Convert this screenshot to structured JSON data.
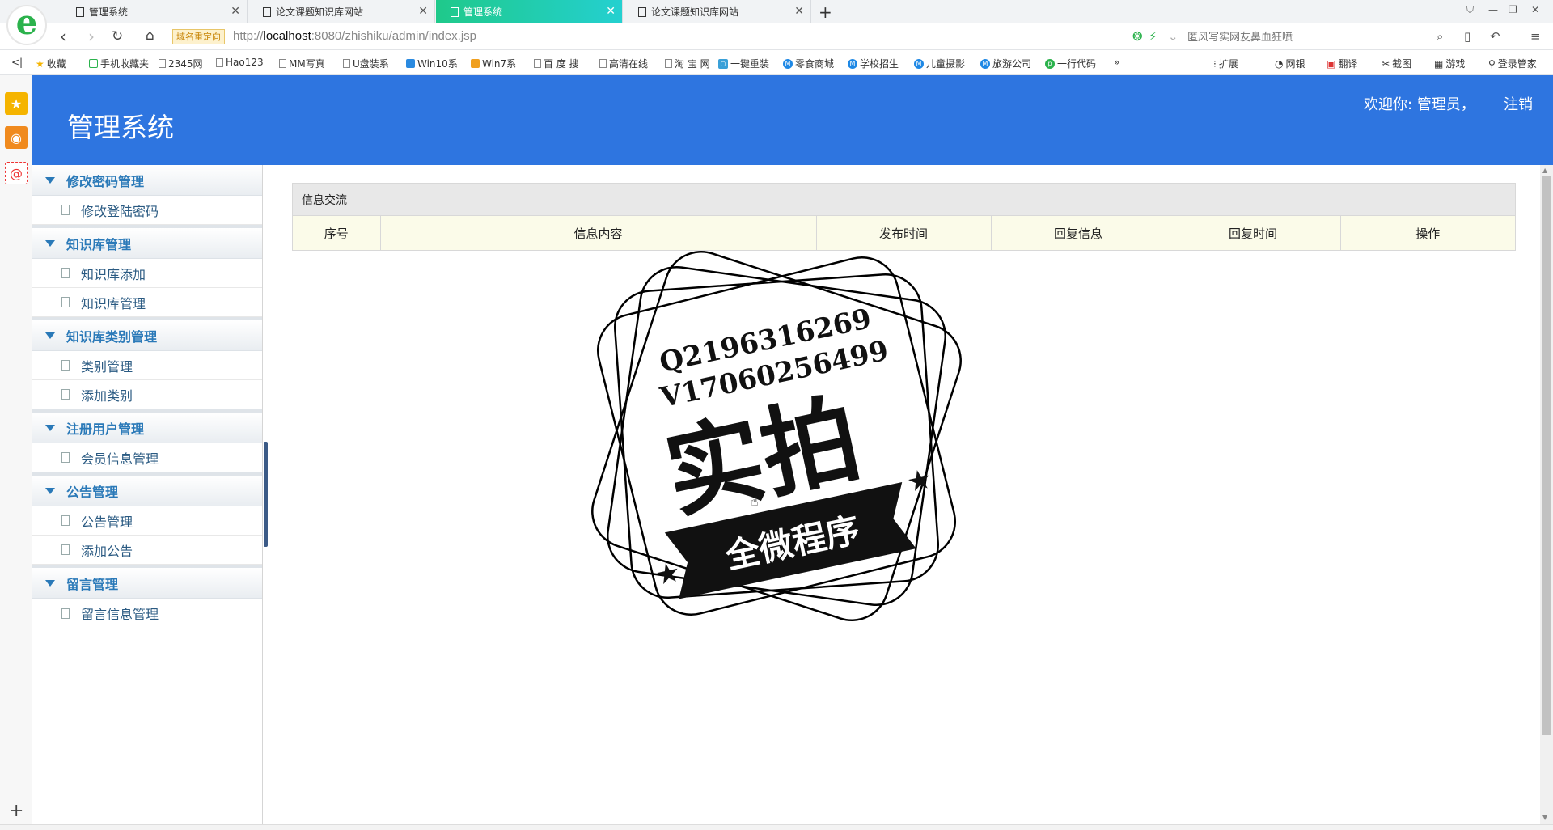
{
  "browser": {
    "tabs": [
      {
        "label": "管理系统",
        "active": false
      },
      {
        "label": "论文课题知识库网站",
        "active": false
      },
      {
        "label": "管理系统",
        "active": true
      },
      {
        "label": "论文课题知识库网站",
        "active": false
      }
    ],
    "redirect_badge": "域名重定向",
    "url_prefix": "http://",
    "url_host": "localhost",
    "url_rest": ":8080/zhishiku/admin/index.jsp",
    "search_placeholder": "匿风写实网友鼻血狂喷",
    "bookmarks": [
      "收藏",
      "手机收藏夹",
      "2345网",
      "Hao123",
      "MM写真",
      "U盘装系",
      "Win10系",
      "Win7系",
      "百 度 搜",
      "高清在线",
      "淘 宝 网",
      "一键重装",
      "零食商城",
      "学校招生",
      "儿童摄影",
      "旅游公司",
      "一行代码"
    ],
    "toolbar_right": [
      "扩展",
      "网银",
      "翻译",
      "截图",
      "游戏",
      "登录管家"
    ],
    "more_glyph": "»"
  },
  "header": {
    "title": "管理系统",
    "welcome": "欢迎你: 管理员，",
    "logout": "注销"
  },
  "menu": {
    "groups": [
      {
        "title": "修改密码管理",
        "items": [
          "修改登陆密码"
        ]
      },
      {
        "title": "知识库管理",
        "items": [
          "知识库添加",
          "知识库管理"
        ]
      },
      {
        "title": "知识库类别管理",
        "items": [
          "类别管理",
          "添加类别"
        ]
      },
      {
        "title": "注册用户管理",
        "items": [
          "会员信息管理"
        ]
      },
      {
        "title": "公告管理",
        "items": [
          "公告管理",
          "添加公告"
        ]
      },
      {
        "title": "留言管理",
        "items": [
          "留言信息管理"
        ]
      }
    ]
  },
  "panel": {
    "title": "信息交流",
    "columns": [
      "序号",
      "信息内容",
      "发布时间",
      "回复信息",
      "回复时间",
      "操作"
    ]
  },
  "watermark": {
    "line1": "Q2196316269",
    "line2": "V17060256499",
    "main": "实拍",
    "banner": "全微程序"
  },
  "colors": {
    "header_bg": "#2e75e0",
    "menu_title": "#2a79b8",
    "active_tab": "#1fc98a"
  }
}
